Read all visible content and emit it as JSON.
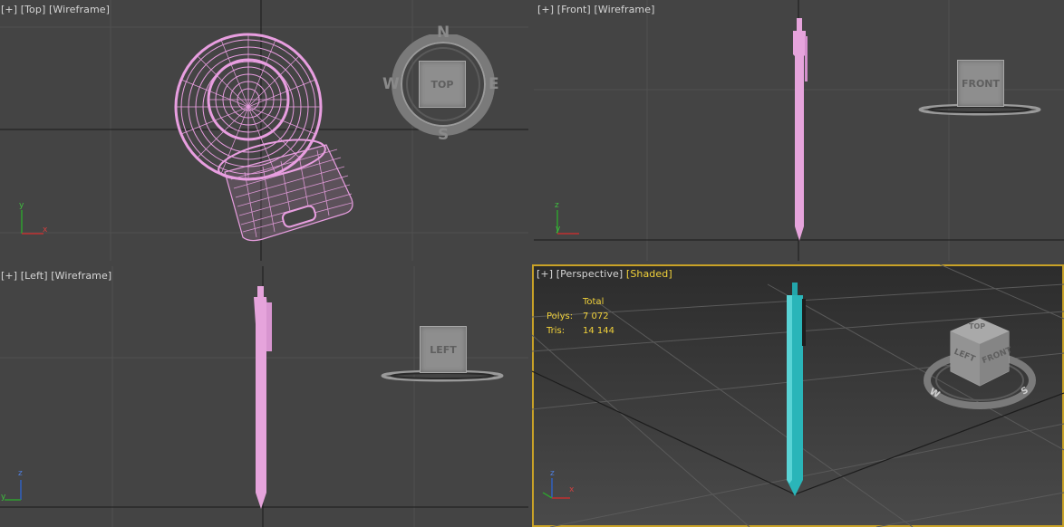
{
  "viewports": {
    "top": {
      "label_plus": "[+]",
      "label_view": "[Top]",
      "label_mode": "[Wireframe]",
      "viewcube_face": "TOP",
      "compass": {
        "n": "N",
        "s": "S",
        "e": "E",
        "w": "W"
      }
    },
    "front": {
      "label_plus": "[+]",
      "label_view": "[Front]",
      "label_mode": "[Wireframe]",
      "viewcube_face": "FRONT"
    },
    "left": {
      "label_plus": "[+]",
      "label_view": "[Left]",
      "label_mode": "[Wireframe]",
      "viewcube_face": "LEFT"
    },
    "perspective": {
      "label_plus": "[+]",
      "label_view": "[Perspective]",
      "label_mode": "[Shaded]",
      "viewcube_faces": {
        "top": "TOP",
        "left": "LEFT",
        "front": "FRONT"
      },
      "stats": {
        "header": "Total",
        "polys_label": "Polys:",
        "polys_value": "7 072",
        "tris_label": "Tris:",
        "tris_value": "14 144"
      }
    }
  },
  "axis_labels": {
    "x": "x",
    "y": "y",
    "z": "z"
  },
  "colors": {
    "viewport_bg": "#444444",
    "grid": "#555555",
    "grid_axis": "#111111",
    "wireframe": "#e89ee0",
    "pen_solid": "#e6a4dc",
    "pen_shaded": "#2ab5b9",
    "active_border": "#c9a227",
    "label_highlight": "#f2d23a"
  }
}
